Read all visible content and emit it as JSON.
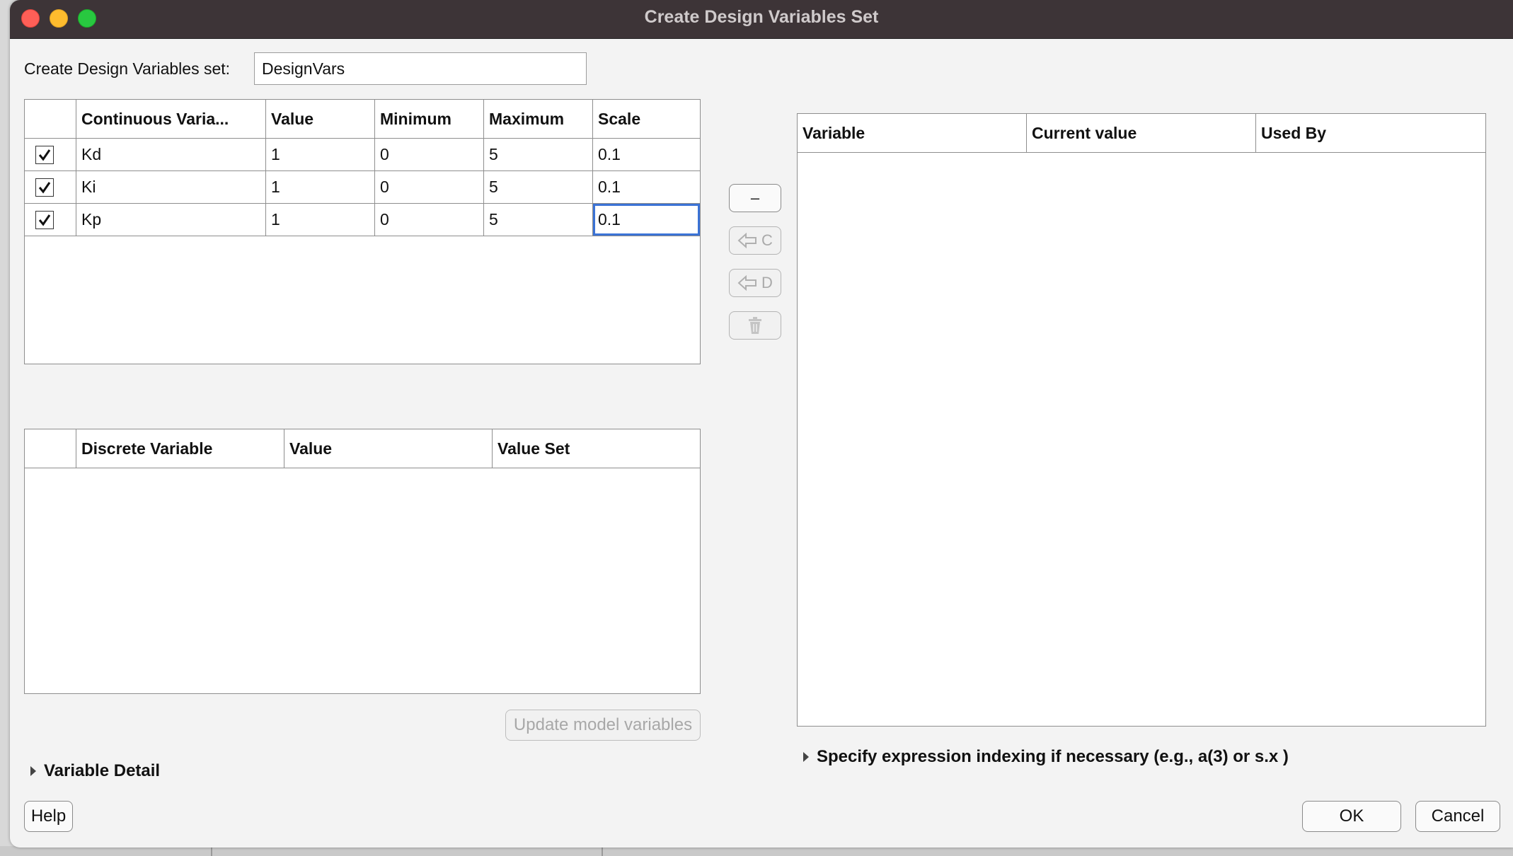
{
  "window": {
    "title": "Create Design Variables Set"
  },
  "name_field": {
    "label": "Create Design Variables set:",
    "value": "DesignVars"
  },
  "continuous_table": {
    "headers": [
      "Continuous Varia...",
      "Value",
      "Minimum",
      "Maximum",
      "Scale"
    ],
    "rows": [
      {
        "checked": true,
        "name": "Kd",
        "value": "1",
        "min": "0",
        "max": "5",
        "scale": "0.1"
      },
      {
        "checked": true,
        "name": "Ki",
        "value": "1",
        "min": "0",
        "max": "5",
        "scale": "0.1"
      },
      {
        "checked": true,
        "name": "Kp",
        "value": "1",
        "min": "0",
        "max": "5",
        "scale": "0.1"
      }
    ]
  },
  "discrete_table": {
    "headers": [
      "Discrete Variable",
      "Value",
      "Value Set"
    ],
    "rows": []
  },
  "side_buttons": {
    "remove": "–",
    "add_continuous": "C",
    "add_discrete": "D"
  },
  "model_table": {
    "headers": [
      "Variable",
      "Current value",
      "Used By"
    ],
    "rows": []
  },
  "buttons": {
    "update": "Update model variables",
    "help": "Help",
    "ok": "OK",
    "cancel": "Cancel"
  },
  "sections": {
    "variable_detail": "Variable Detail",
    "indexing": "Specify expression indexing if necessary (e.g., a(3) or s.x )"
  }
}
